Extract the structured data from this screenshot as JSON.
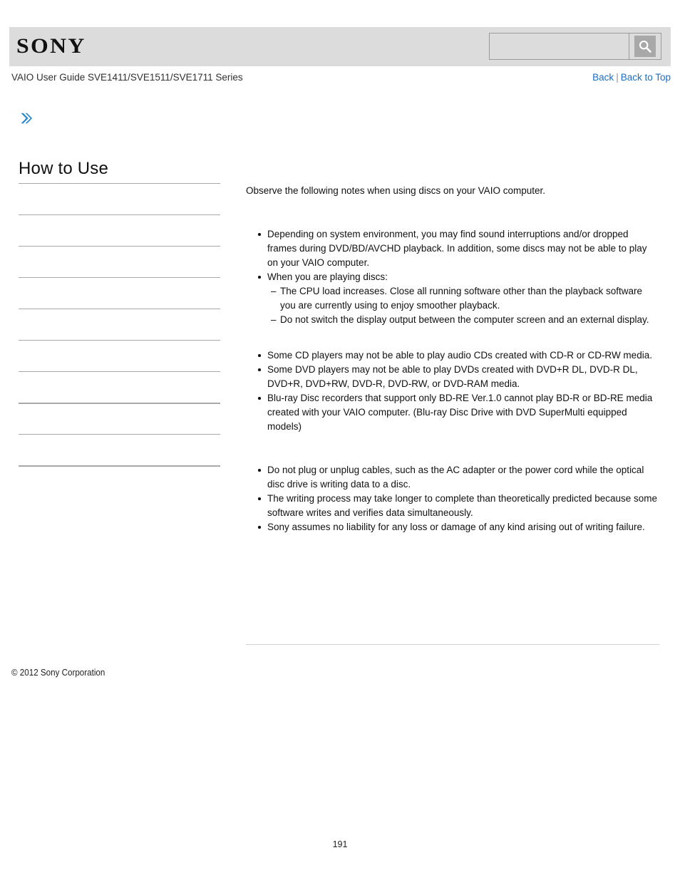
{
  "header": {
    "logo_text": "SONY",
    "search": {
      "value": "",
      "placeholder": "",
      "button_icon": "search-icon",
      "button_label": "Search"
    }
  },
  "subheader": {
    "guide_title": "VAIO User Guide SVE1411/SVE1511/SVE1711 Series",
    "links": {
      "back": "Back",
      "separator": "|",
      "back_to_top": "Back to Top"
    }
  },
  "sidebar": {
    "expand_icon": "double-chevron-right-icon",
    "heading": "How to Use",
    "items": [
      {
        "label": "",
        "divider": "thin"
      },
      {
        "label": "",
        "divider": "thin"
      },
      {
        "label": "",
        "divider": "thin"
      },
      {
        "label": "",
        "divider": "thin"
      },
      {
        "label": "",
        "divider": "thin"
      },
      {
        "label": "",
        "divider": "thin"
      },
      {
        "label": "",
        "divider": "thin"
      },
      {
        "label": "",
        "divider": "thick"
      },
      {
        "label": "",
        "divider": "thin"
      },
      {
        "label": "",
        "divider": "thick"
      }
    ]
  },
  "main": {
    "lead": "Observe the following notes when using discs on your VAIO computer.",
    "groups": [
      {
        "bullets": [
          {
            "text": "Depending on system environment, you may find sound interruptions and/or dropped frames during DVD/BD/AVCHD playback. In addition, some discs may not be able to play on your VAIO computer.",
            "sub": []
          },
          {
            "text": "When you are playing discs:",
            "sub": [
              "The CPU load increases. Close all running software other than the playback software you are currently using to enjoy smoother playback.",
              "Do not switch the display output between the computer screen and an external display."
            ]
          }
        ]
      },
      {
        "bullets": [
          {
            "text": "Some CD players may not be able to play audio CDs created with CD-R or CD-RW media.",
            "sub": []
          },
          {
            "text": "Some DVD players may not be able to play DVDs created with DVD+R DL, DVD-R DL, DVD+R, DVD+RW, DVD-R, DVD-RW, or DVD-RAM media.",
            "sub": []
          },
          {
            "text": "Blu-ray Disc recorders that support only BD-RE Ver.1.0 cannot play BD-R or BD-RE media created with your VAIO computer. (Blu-ray Disc Drive with DVD SuperMulti equipped models)",
            "sub": []
          }
        ]
      },
      {
        "bullets": [
          {
            "text": "Do not plug or unplug cables, such as the AC adapter or the power cord while the optical disc drive is writing data to a disc.",
            "sub": []
          },
          {
            "text": "The writing process may take longer to complete than theoretically predicted because some software writes and verifies data simultaneously.",
            "sub": []
          },
          {
            "text": "Sony assumes no liability for any loss or damage of any kind arising out of writing failure.",
            "sub": []
          }
        ]
      }
    ]
  },
  "footer": {
    "copyright": "© 2012 Sony Corporation",
    "page_number": "191"
  },
  "colors": {
    "header_band": "#dcdcdc",
    "link_blue": "#1a6fc4",
    "chevron_blue": "#2a86c8",
    "divider_gray": "#a9a9a9",
    "content_rule": "#cfcfcf"
  }
}
